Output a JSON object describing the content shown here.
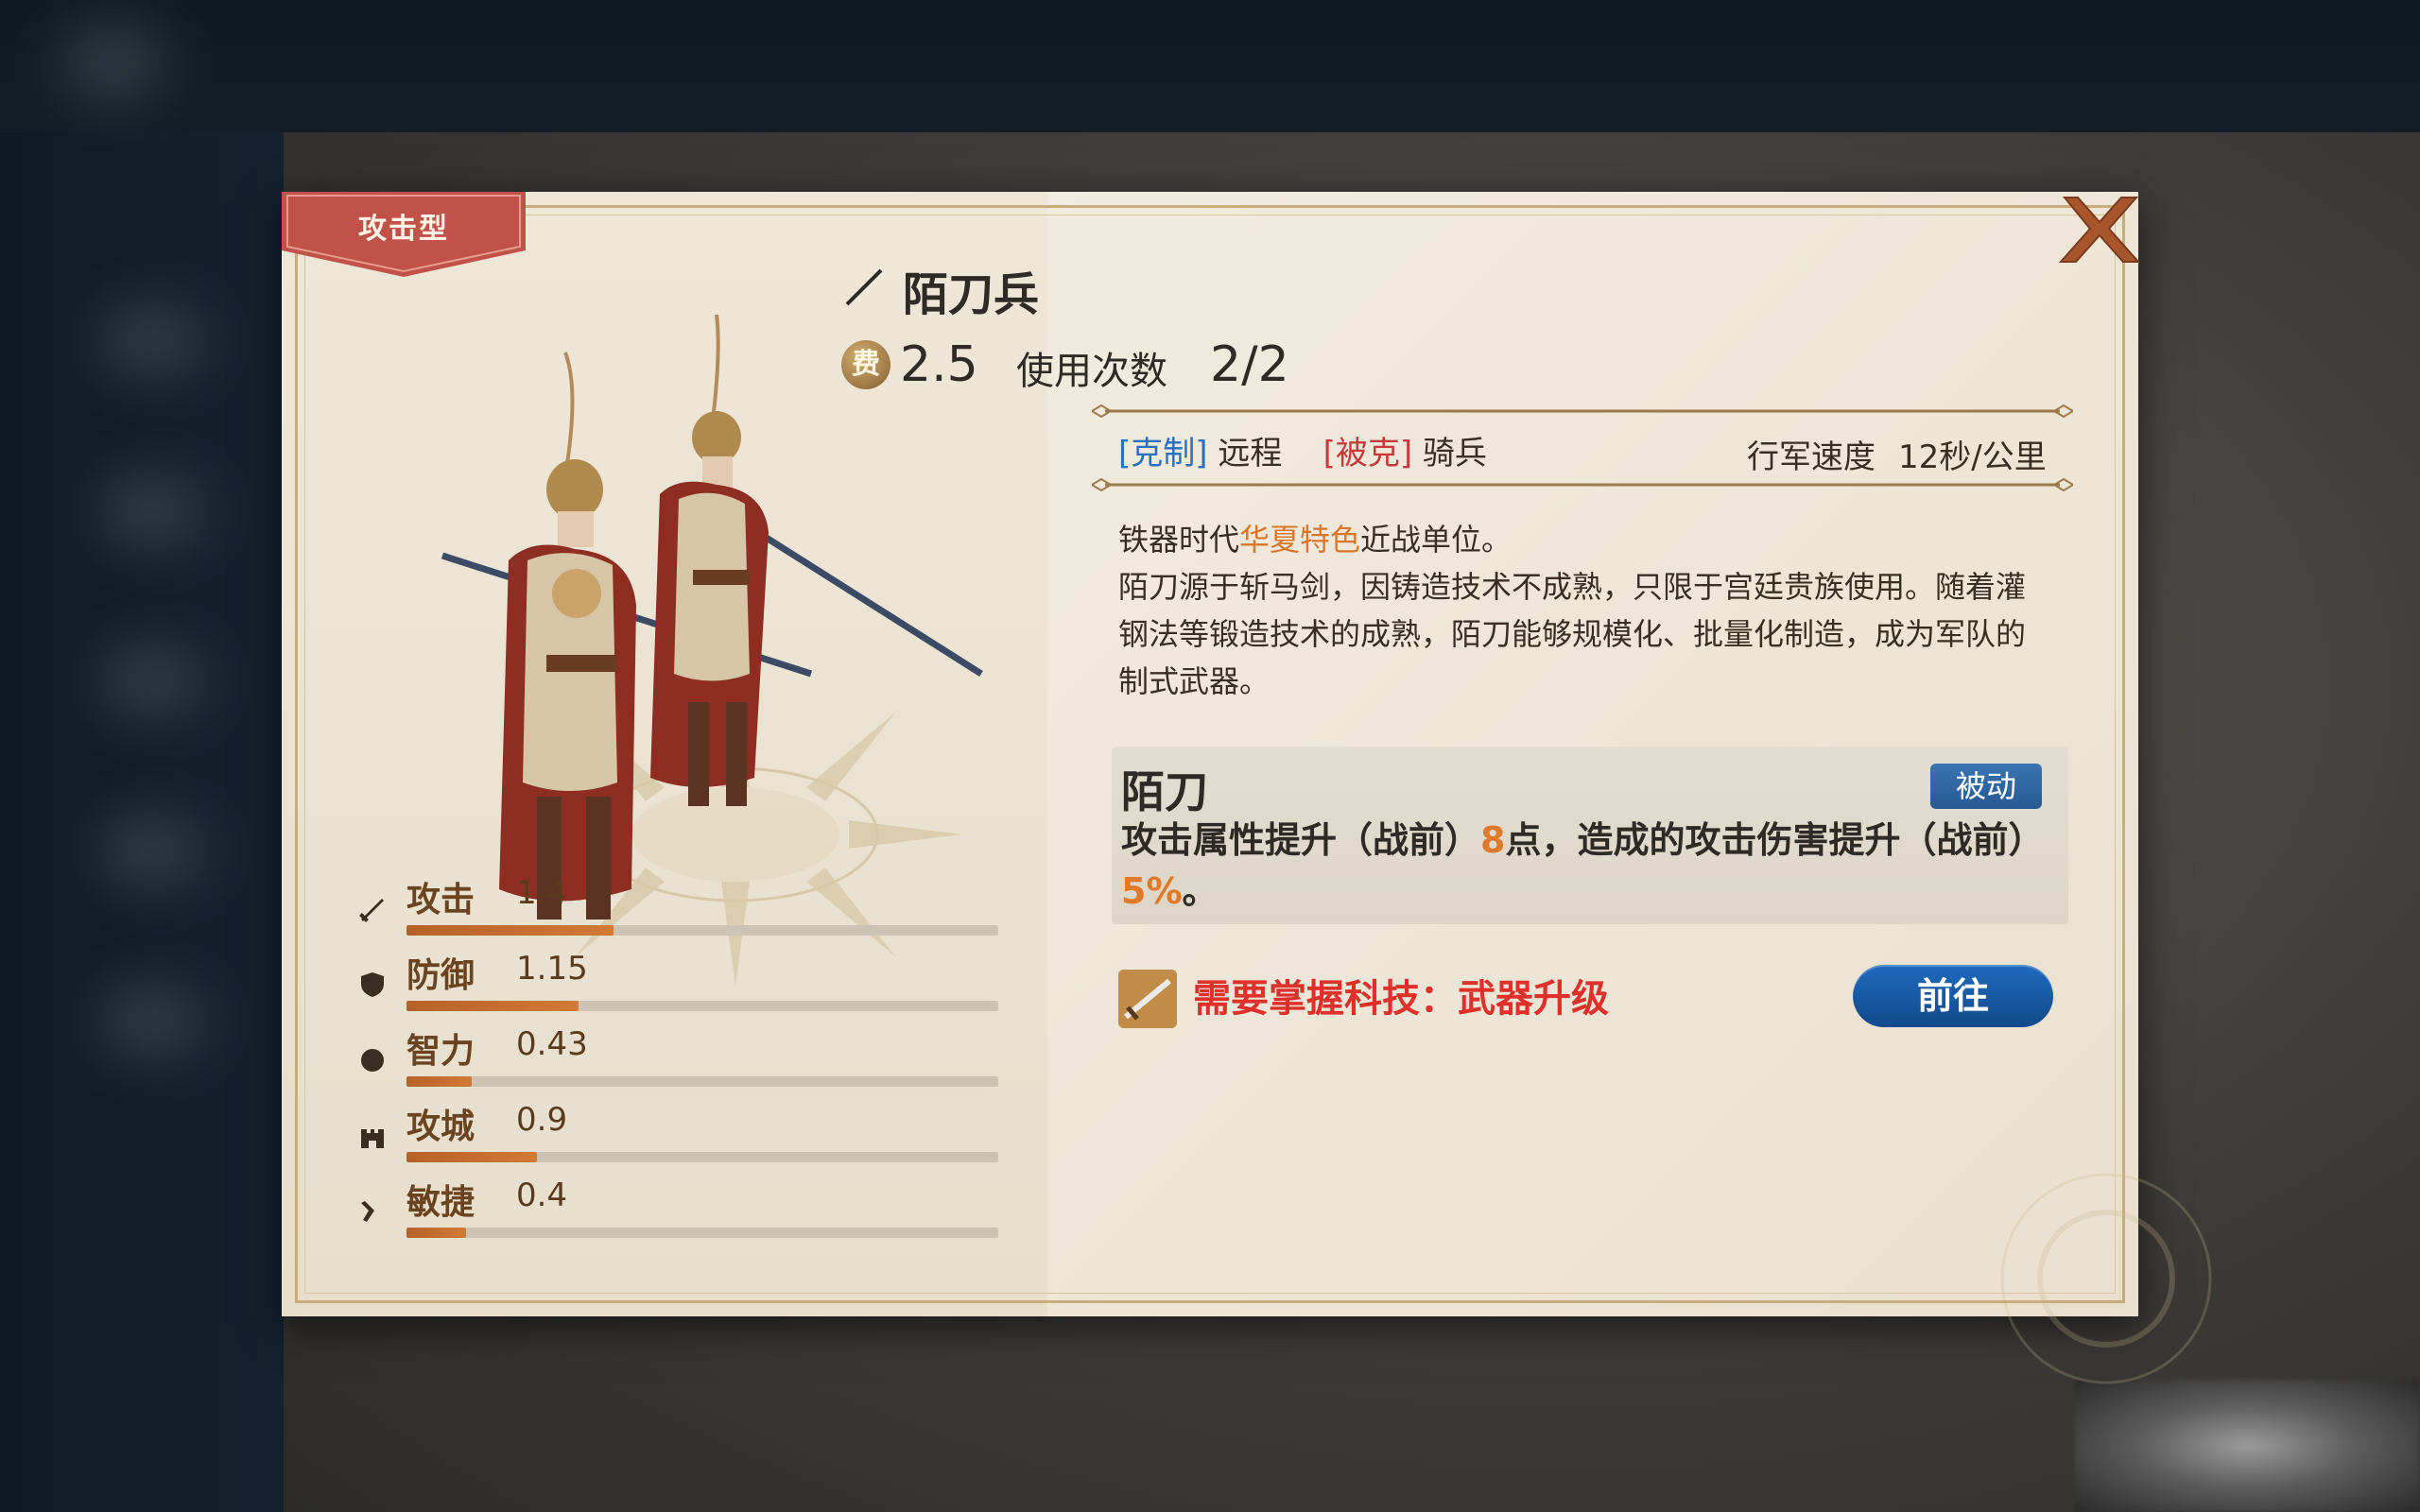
{
  "unit": {
    "type_ribbon": "攻击型",
    "name": "陌刀兵",
    "cost_icon_label": "费",
    "cost": "2.5",
    "uses_label": "使用次数",
    "uses": "2/2",
    "counter_tag": "[克制]",
    "counter_target": "远程",
    "countered_tag": "[被克]",
    "countered_by": "骑兵",
    "march_label": "行军速度",
    "march_speed": "12秒/公里"
  },
  "description": {
    "line1_prefix": "铁器时代",
    "line1_highlight": "华夏特色",
    "line1_suffix": "近战单位。",
    "body": "陌刀源于斩马剑，因铸造技术不成熟，只限于宫廷贵族使用。随着灌钢法等锻造技术的成熟，陌刀能够规模化、批量化制造，成为军队的制式武器。"
  },
  "skill": {
    "name": "陌刀",
    "badge": "被动",
    "desc_part1": "攻击属性提升（战前）",
    "desc_num1": "8",
    "desc_part2": "点，造成的攻击伤害提升（战前）",
    "desc_num2": "5%",
    "desc_part3": "。"
  },
  "tech": {
    "text": "需要掌握科技：武器升级",
    "button": "前往"
  },
  "stats": [
    {
      "label": "攻击",
      "value": "1.4",
      "fill": 0.35,
      "icon": "sword-icon"
    },
    {
      "label": "防御",
      "value": "1.15",
      "fill": 0.29,
      "icon": "shield-icon"
    },
    {
      "label": "智力",
      "value": "0.43",
      "fill": 0.11,
      "icon": "brain-icon"
    },
    {
      "label": "攻城",
      "value": "0.9",
      "fill": 0.22,
      "icon": "castle-icon"
    },
    {
      "label": "敏捷",
      "value": "0.4",
      "fill": 0.1,
      "icon": "boot-icon"
    }
  ],
  "colors": {
    "ribbon": "#c0524a",
    "stat_fill": "#c06a2e",
    "highlight": "#d9762a",
    "counter": "#2a6fc0",
    "countered": "#c83a3a",
    "tech_red": "#e0302c",
    "button_blue": "#1a5fa8"
  }
}
